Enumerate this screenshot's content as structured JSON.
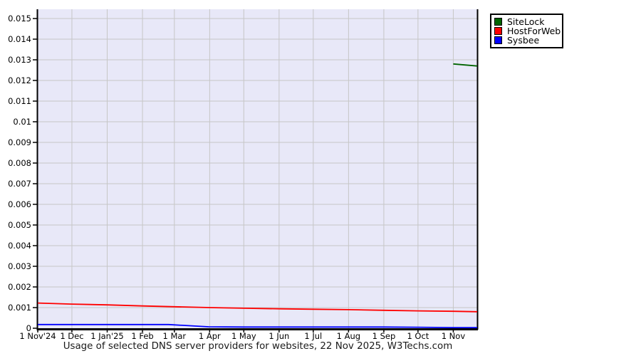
{
  "chart_data": {
    "type": "line",
    "title": "Usage of selected DNS server providers for websites, 22 Nov 2025, W3Techs.com",
    "source": "W3Techs.com",
    "as_of_date": "22 Nov 2025",
    "grid": true,
    "legend_position": "top-right",
    "plot_bg_color": "#e8e8f8",
    "grid_color": "#c6c6c6",
    "axis_color": "#000000",
    "x_axis": {
      "range_days": [
        0,
        386
      ],
      "ticks": [
        {
          "label": "1 Nov'24",
          "day": 0
        },
        {
          "label": "1 Dec",
          "day": 30
        },
        {
          "label": "1 Jan'25",
          "day": 61
        },
        {
          "label": "1 Feb",
          "day": 92
        },
        {
          "label": "1 Mar",
          "day": 120
        },
        {
          "label": "1 Apr",
          "day": 151
        },
        {
          "label": "1 May",
          "day": 181
        },
        {
          "label": "1 Jun",
          "day": 212
        },
        {
          "label": "1 Jul",
          "day": 242
        },
        {
          "label": "1 Aug",
          "day": 273
        },
        {
          "label": "1 Sep",
          "day": 304
        },
        {
          "label": "1 Oct",
          "day": 334
        },
        {
          "label": "1 Nov",
          "day": 365
        }
      ]
    },
    "y_axis": {
      "min": 0,
      "max": 0.015,
      "tick_step": 0.001,
      "tick_labels": [
        "0",
        "0.001",
        "0.002",
        "0.003",
        "0.004",
        "0.005",
        "0.006",
        "0.007",
        "0.008",
        "0.009",
        "0.01",
        "0.011",
        "0.012",
        "0.013",
        "0.014",
        "0.015"
      ]
    },
    "series": [
      {
        "name": "Sysbee",
        "color": "#0000ff",
        "points": [
          [
            0,
            0.00018
          ],
          [
            30,
            0.00018
          ],
          [
            61,
            0.00018
          ],
          [
            92,
            0.00018
          ],
          [
            115,
            0.00018
          ],
          [
            150,
            7e-05
          ],
          [
            181,
            6e-05
          ],
          [
            212,
            6e-05
          ],
          [
            242,
            6e-05
          ],
          [
            273,
            6e-05
          ],
          [
            304,
            6e-05
          ],
          [
            334,
            5e-05
          ],
          [
            365,
            3e-05
          ],
          [
            386,
            3e-05
          ]
        ]
      },
      {
        "name": "HostForWeb",
        "color": "#ff0000",
        "points": [
          [
            0,
            0.00122
          ],
          [
            30,
            0.00117
          ],
          [
            61,
            0.00113
          ],
          [
            92,
            0.00108
          ],
          [
            120,
            0.00104
          ],
          [
            151,
            0.001
          ],
          [
            181,
            0.00097
          ],
          [
            212,
            0.00094
          ],
          [
            242,
            0.00092
          ],
          [
            273,
            0.0009
          ],
          [
            304,
            0.00087
          ],
          [
            334,
            0.00084
          ],
          [
            365,
            0.00082
          ],
          [
            386,
            0.0008
          ]
        ]
      },
      {
        "name": "SiteLock",
        "color": "#006400",
        "points": [
          [
            365,
            0.0128
          ],
          [
            386,
            0.0127
          ]
        ]
      }
    ],
    "legend_order": [
      "SiteLock",
      "HostForWeb",
      "Sysbee"
    ]
  }
}
